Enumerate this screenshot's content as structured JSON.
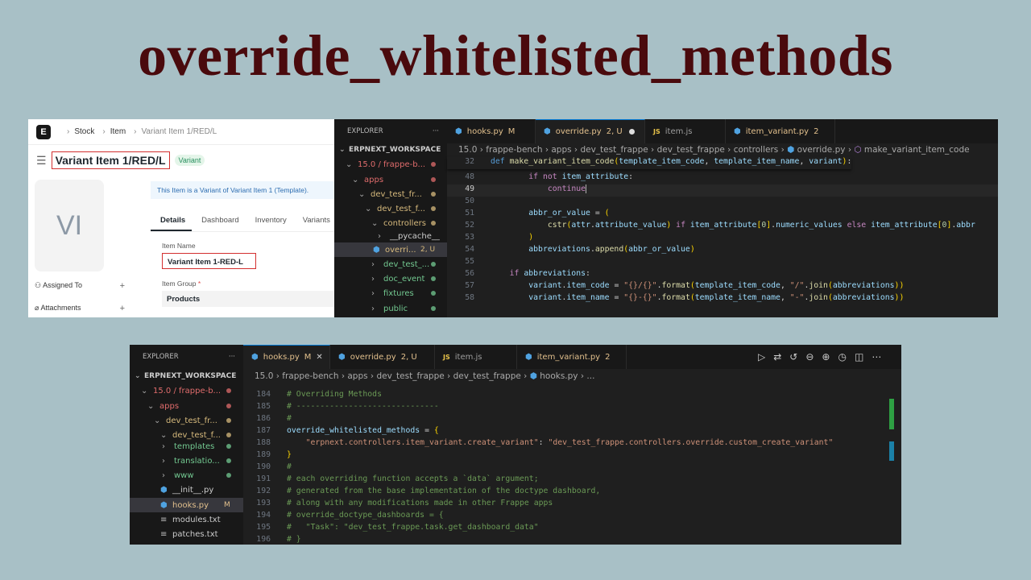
{
  "title": "override_whitelisted_methods",
  "erp": {
    "logo": "E",
    "breadcrumb": [
      "Stock",
      "Item",
      "Variant Item 1/RED/L"
    ],
    "doc_title": "Variant Item 1/RED/L",
    "badge": "Variant",
    "avatar": "VI",
    "assigned_to": "Assigned To",
    "attachments": "Attachments",
    "info_prefix": "This Item is a Variant of ",
    "info_link": "Variant Item 1 (Template).",
    "tabs": [
      "Details",
      "Dashboard",
      "Inventory",
      "Variants"
    ],
    "item_name_label": "Item Name",
    "item_name_value": "Variant Item 1-RED-L",
    "item_group_label": "Item Group",
    "item_group_required": "*",
    "item_group_value": "Products"
  },
  "top_editor": {
    "explorer_label": "EXPLORER",
    "more": "···",
    "workspace": "ERPNEXT_WORKSPACE",
    "tree": [
      {
        "label": "15.0 / frappe-b...",
        "color": "#e06c6c"
      },
      {
        "label": "apps",
        "color": "#e06c6c"
      },
      {
        "label": "dev_test_fr...",
        "color": "#d7ba7d"
      },
      {
        "label": "dev_test_f...",
        "color": "#d7ba7d"
      },
      {
        "label": "controllers",
        "color": "#d7ba7d"
      },
      {
        "label": "__pycache__",
        "color": "#cccccc"
      },
      {
        "label": "overri...",
        "badge": "2, U",
        "color": "#d7ba7d"
      },
      {
        "label": "dev_test_...",
        "color": "#73c991"
      },
      {
        "label": "doc_event",
        "color": "#73c991"
      },
      {
        "label": "fixtures",
        "color": "#73c991"
      },
      {
        "label": "public",
        "color": "#73c991"
      }
    ],
    "tabs": [
      {
        "name": "hooks.py",
        "suffix": "M"
      },
      {
        "name": "override.py",
        "suffix": "2, U"
      },
      {
        "name": "item.js",
        "suffix": ""
      },
      {
        "name": "item_variant.py",
        "suffix": "2"
      }
    ],
    "breadcrumb": "15.0 › frappe-bench › apps › dev_test_frappe › dev_test_frappe › controllers ›",
    "bc_file": "override.py",
    "bc_symbol": "make_variant_item_code",
    "sticky_num": "32",
    "sticky_line": "def make_variant_item_code(template_item_code, template_item_name, variant):",
    "line_numbers": [
      "48",
      "49",
      "50",
      "51",
      "52",
      "53",
      "54",
      "55",
      "56",
      "57",
      "58"
    ],
    "code": [
      "        if not item_attribute:",
      "            continue",
      "",
      "        abbr_or_value = (",
      "            cstr(attr.attribute_value) if item_attribute[0].numeric_values else item_attribute[0].abbr",
      "        )",
      "        abbreviations.append(abbr_or_value)",
      "",
      "    if abbreviations:",
      "        variant.item_code = \"{}/{}\".format(template_item_code, \"/\".join(abbreviations))",
      "        variant.item_name = \"{}-{}\".format(template_item_name, \"-\".join(abbreviations))"
    ]
  },
  "bottom_editor": {
    "explorer_label": "EXPLORER",
    "more": "···",
    "workspace": "ERPNEXT_WORKSPACE",
    "tree": [
      {
        "label": "15.0 / frappe-b...",
        "color": "#e06c6c"
      },
      {
        "label": "apps",
        "color": "#e06c6c"
      },
      {
        "label": "dev_test_fr...",
        "color": "#d7ba7d"
      },
      {
        "label": "dev_test_f...",
        "color": "#d7ba7d"
      },
      {
        "label": "templates",
        "color": "#73c991"
      },
      {
        "label": "translatio...",
        "color": "#73c991"
      },
      {
        "label": "www",
        "color": "#73c991"
      },
      {
        "label": "__init__.py",
        "color": "#cccccc"
      },
      {
        "label": "hooks.py",
        "badge": "M",
        "color": "#e2c08d"
      },
      {
        "label": "modules.txt",
        "color": "#cccccc"
      },
      {
        "label": "patches.txt",
        "color": "#cccccc"
      }
    ],
    "tabs": [
      {
        "name": "hooks.py",
        "suffix": "M"
      },
      {
        "name": "override.py",
        "suffix": "2, U"
      },
      {
        "name": "item.js",
        "suffix": ""
      },
      {
        "name": "item_variant.py",
        "suffix": "2"
      }
    ],
    "breadcrumb": "15.0 › frappe-bench › apps › dev_test_frappe › dev_test_frappe ›",
    "bc_file": "hooks.py",
    "bc_tail": "› ...",
    "line_numbers": [
      "184",
      "185",
      "186",
      "187",
      "188",
      "189",
      "190",
      "191",
      "192",
      "193",
      "194",
      "195",
      "196"
    ],
    "code": [
      "# Overriding Methods",
      "# ------------------------------",
      "#",
      "override_whitelisted_methods = {",
      "    \"erpnext.controllers.item_variant.create_variant\": \"dev_test_frappe.controllers.override.custom_create_variant\"",
      "}",
      "#",
      "# each overriding function accepts a `data` argument;",
      "# generated from the base implementation of the doctype dashboard,",
      "# along with any modifications made in other Frappe apps",
      "# override_doctype_dashboards = {",
      "#   \"Task\": \"dev_test_frappe.task.get_dashboard_data\"",
      "# }"
    ]
  }
}
